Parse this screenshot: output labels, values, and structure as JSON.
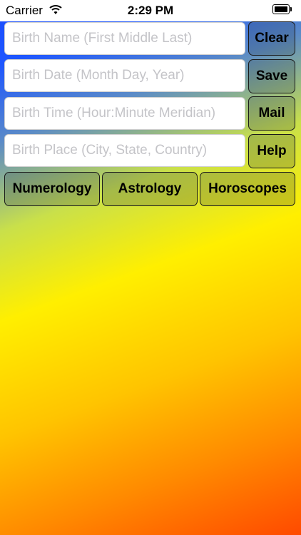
{
  "status_bar": {
    "carrier": "Carrier",
    "time": "2:29 PM"
  },
  "form": {
    "birth_name_placeholder": "Birth Name (First Middle Last)",
    "birth_date_placeholder": "Birth Date (Month Day, Year)",
    "birth_time_placeholder": "Birth Time (Hour:Minute Meridian)",
    "birth_place_placeholder": "Birth Place (City, State, Country)"
  },
  "actions": {
    "clear": "Clear",
    "save": "Save",
    "mail": "Mail",
    "help": "Help"
  },
  "tabs": {
    "numerology": "Numerology",
    "astrology": "Astrology",
    "horoscopes": "Horoscopes"
  },
  "colors": {
    "background_top": "#1e56ff",
    "background_middle": "#ffef00",
    "background_bottom": "#ff4a00"
  }
}
